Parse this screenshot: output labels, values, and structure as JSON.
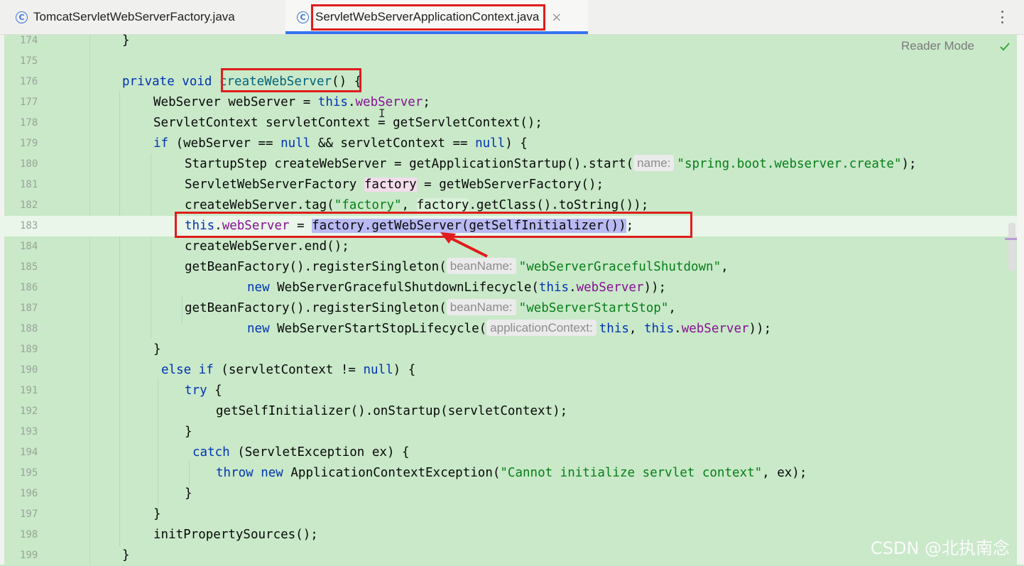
{
  "tabs": [
    {
      "label": "TomcatServletWebServerFactory.java",
      "icon": "class-c-icon"
    },
    {
      "label": "ServletWebServerApplicationContext.java",
      "icon": "class-c-icon",
      "active": true,
      "close": "×"
    }
  ],
  "editor": {
    "reader_mode": "Reader Mode",
    "watermark": "CSDN @北执南念",
    "accent": "#3574f0",
    "annotation_color": "#e01c1c"
  },
  "lines": [
    {
      "num": "174"
    },
    {
      "num": "175"
    },
    {
      "num": "176"
    },
    {
      "num": "177"
    },
    {
      "num": "178"
    },
    {
      "num": "179"
    },
    {
      "num": "180"
    },
    {
      "num": "181"
    },
    {
      "num": "182"
    },
    {
      "num": "183"
    },
    {
      "num": "184"
    },
    {
      "num": "185"
    },
    {
      "num": "186"
    },
    {
      "num": "187"
    },
    {
      "num": "188"
    },
    {
      "num": "189"
    },
    {
      "num": "190"
    },
    {
      "num": "191"
    },
    {
      "num": "192"
    },
    {
      "num": "193"
    },
    {
      "num": "194"
    },
    {
      "num": "195"
    },
    {
      "num": "196"
    },
    {
      "num": "197"
    },
    {
      "num": "198"
    },
    {
      "num": "199"
    }
  ],
  "code": {
    "l174": "}",
    "l176_kw": "private void",
    "l176_name": "createWebServer",
    "l176_rest": "() {",
    "l177_a": "WebServer webServer = ",
    "l177_this": "this",
    "l177_dot": ".",
    "l177_fld": "webServer",
    "l177_end": ";",
    "l178": "ServletContext servletContext = getServletContext();",
    "l179_if": "if",
    "l179_a": " (webServer == ",
    "l179_null1": "null",
    "l179_b": " && servletContext == ",
    "l179_null2": "null",
    "l179_c": ") {",
    "l180_a": "StartupStep createWebServer = getApplicationStartup().start(",
    "l180_hint": "name:",
    "l180_str": "\"spring.boot.webserver.create\"",
    "l180_end": ");",
    "l181_a": "ServletWebServerFactory ",
    "l181_var": "factory",
    "l181_b": " = getWebServerFactory();",
    "l182_a": "createWebServer.tag(",
    "l182_str": "\"factory\"",
    "l182_b": ", ",
    "l182_var": "factory",
    "l182_c": ".getClass().toString());",
    "l183_this": "this",
    "l183_dot": ".",
    "l183_fld": "webServer",
    "l183_eq": " = ",
    "l183_call": "factory.getWebServer(getSelfInitializer())",
    "l183_end": ";",
    "l184": "createWebServer.end();",
    "l185_a": "getBeanFactory().registerSingleton(",
    "l185_hint": "beanName:",
    "l185_str": "\"webServerGracefulShutdown\"",
    "l185_end": ",",
    "l186_new": "new",
    "l186_a": " WebServerGracefulShutdownLifecycle(",
    "l186_this": "this",
    "l186_dot": ".",
    "l186_fld": "webServer",
    "l186_end": "));",
    "l187_a": "getBeanFactory().registerSingleton(",
    "l187_hint": "beanName:",
    "l187_str": "\"webServerStartStop\"",
    "l187_end": ",",
    "l188_new": "new",
    "l188_a": " WebServerStartStopLifecycle(",
    "l188_hint": "applicationContext:",
    "l188_this1": "this",
    "l188_b": ", ",
    "l188_this2": "this",
    "l188_dot": ".",
    "l188_fld": "webServer",
    "l188_end": "));",
    "l189": "}",
    "l190_kw": "else if",
    "l190_a": " (servletContext != ",
    "l190_null": "null",
    "l190_b": ") {",
    "l191_kw": "try",
    "l191_a": " {",
    "l192": "getSelfInitializer().onStartup(servletContext);",
    "l193": "}",
    "l194_kw": "catch",
    "l194_a": " (ServletException ex) {",
    "l195_throw": "throw",
    "l195_sp": " ",
    "l195_new": "new",
    "l195_a": " ApplicationContextException(",
    "l195_str": "\"Cannot initialize servlet context\"",
    "l195_b": ", ex);",
    "l196": "}",
    "l197": "}",
    "l198": "initPropertySources();",
    "l199": "}"
  }
}
